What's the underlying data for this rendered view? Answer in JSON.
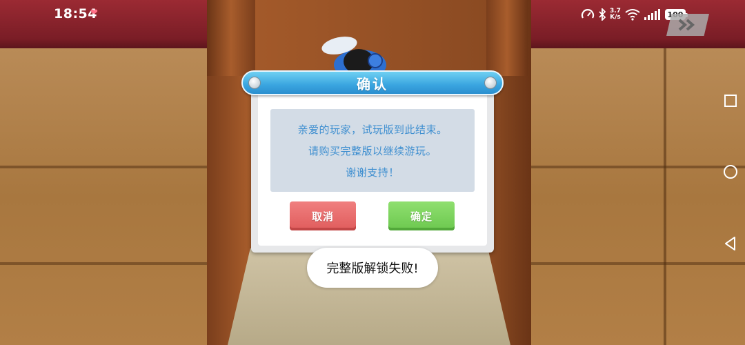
{
  "status_bar": {
    "time": "18:54",
    "net_speed_value": "3.7",
    "net_speed_unit": "K/s",
    "battery": "100"
  },
  "dialog": {
    "title": "确认",
    "message_lines": [
      "亲爱的玩家，试玩版到此结束。",
      "请购买完整版以继续游玩。",
      "谢谢支持！"
    ],
    "cancel_label": "取消",
    "ok_label": "确定"
  },
  "toast": {
    "text": "完整版解锁失败!"
  },
  "icons": {
    "skip": "fast-forward-icon",
    "nav_recent": "square-icon",
    "nav_home": "circle-icon",
    "nav_back": "triangle-back-icon"
  },
  "colors": {
    "title_bar": "#3aa5e0",
    "message_text": "#3f8fd0",
    "cancel_button": "#e86a6a",
    "ok_button": "#79d25a"
  }
}
